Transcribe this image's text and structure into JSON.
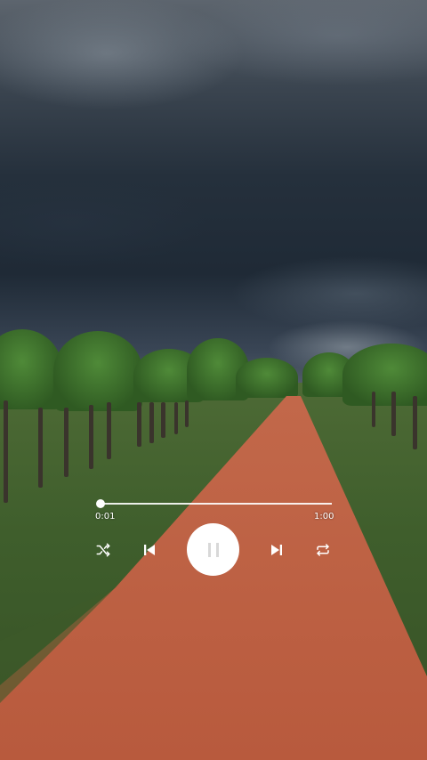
{
  "player": {
    "current_time": "0:01",
    "duration": "1:00",
    "progress_fraction": 0.0,
    "state": "playing",
    "accent_color": "#ffffff"
  },
  "controls": [
    {
      "name": "shuffle-button",
      "icon": "shuffle-icon"
    },
    {
      "name": "previous-button",
      "icon": "skip-previous-icon"
    },
    {
      "name": "pause-button",
      "icon": "pause-icon"
    },
    {
      "name": "next-button",
      "icon": "skip-next-icon"
    },
    {
      "name": "repeat-button",
      "icon": "repeat-icon"
    }
  ]
}
